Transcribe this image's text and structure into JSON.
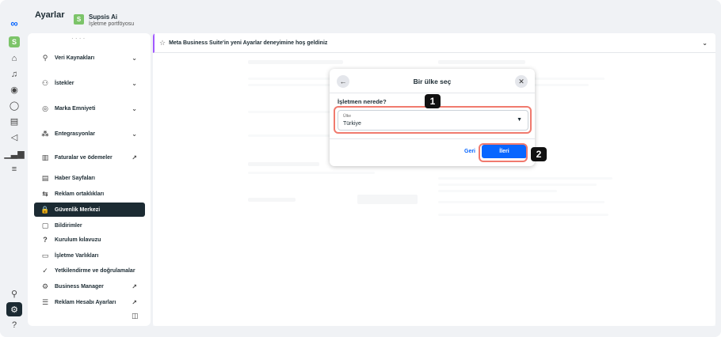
{
  "header": {
    "app_title": "Ayarlar",
    "portfolio_initial": "S",
    "portfolio_name": "Supsis Ai",
    "portfolio_subtitle": "İşletme portföyosu"
  },
  "rail": {
    "avatar_initial": "S"
  },
  "sidebar": {
    "items": [
      {
        "label": "Veri Kaynakları",
        "icon": "data-sources-icon",
        "glyph": "⚲",
        "trailing": "chevron"
      },
      {
        "label": "İstekler",
        "icon": "requests-icon",
        "glyph": "⚇",
        "trailing": "chevron"
      },
      {
        "label": "Marka Emniyeti",
        "icon": "brand-safety-icon",
        "glyph": "◎",
        "trailing": "chevron"
      },
      {
        "label": "Entegrasyonlar",
        "icon": "integrations-icon",
        "glyph": "⁂",
        "trailing": "chevron"
      },
      {
        "label": "Faturalar ve ödemeler",
        "icon": "billing-icon",
        "glyph": "▥",
        "trailing": "external"
      },
      {
        "label": "Haber Sayfaları",
        "icon": "news-icon",
        "glyph": "▤",
        "trailing": ""
      },
      {
        "label": "Reklam ortaklıkları",
        "icon": "ad-partnership-icon",
        "glyph": "⇆",
        "trailing": ""
      },
      {
        "label": "Güvenlik Merkezi",
        "icon": "lock-icon",
        "glyph": "🔒",
        "trailing": "",
        "active": true
      },
      {
        "label": "Bildirimler",
        "icon": "notification-icon",
        "glyph": "▢",
        "trailing": ""
      },
      {
        "label": "Kurulum kılavuzu",
        "icon": "help-icon",
        "glyph": "?",
        "trailing": ""
      },
      {
        "label": "İşletme Varlıkları",
        "icon": "assets-icon",
        "glyph": "▭",
        "trailing": ""
      },
      {
        "label": "Yetkilendirme ve doğrulamalar",
        "icon": "verify-icon",
        "glyph": "✓",
        "trailing": ""
      },
      {
        "label": "Business Manager",
        "icon": "settings-icon",
        "glyph": "⚙",
        "trailing": "external"
      },
      {
        "label": "Reklam Hesabı Ayarları",
        "icon": "ad-account-icon",
        "glyph": "☰",
        "trailing": "external"
      }
    ]
  },
  "banner": {
    "text": "Meta Business Suite'in yeni Ayarlar deneyimine hoş geldiniz"
  },
  "modal": {
    "title": "Bir ülke seç",
    "question": "İşletmen nerede?",
    "select_label": "Ülke",
    "select_value": "Türkiye",
    "back_label": "Geri",
    "next_label": "İleri"
  },
  "annotations": {
    "step1": "1",
    "step2": "2",
    "highlight_color": "#f07a6e"
  },
  "colors": {
    "accent": "#0866ff",
    "avatar": "#7cc469",
    "active_item": "#1c2b33"
  }
}
